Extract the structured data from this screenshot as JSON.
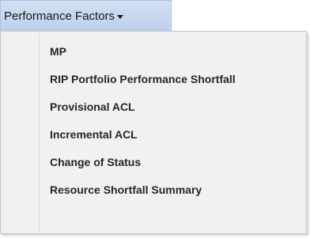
{
  "menu": {
    "title": "Performance Factors",
    "caret_icon": "caret-down-icon",
    "items": [
      {
        "label": "MP"
      },
      {
        "label": "RIP Portfolio Performance Shortfall"
      },
      {
        "label": "Provisional ACL"
      },
      {
        "label": "Incremental ACL"
      },
      {
        "label": "Change of Status"
      },
      {
        "label": "Resource Shortfall Summary"
      }
    ]
  }
}
